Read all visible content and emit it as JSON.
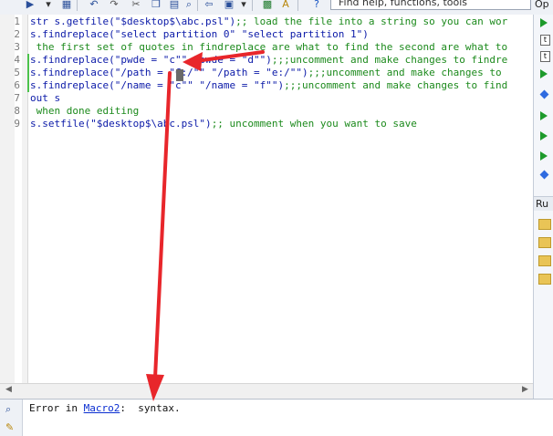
{
  "toolbar": {
    "help_placeholder": "Find help, functions, tools",
    "options_tab": "Op"
  },
  "editor": {
    "lines": [
      {
        "num": "1",
        "code": "str s.getfile(\"$desktop$\\abc.psl\")",
        "comment": ";; load the file into a string so you can wor"
      },
      {
        "num": "2",
        "code": "s.findreplace(\"select partition 0\" \"select partition 1\")",
        "comment": ""
      },
      {
        "num": "3",
        "code": "",
        "comment": " the first set of quotes in findreplace are what to find the second are what to"
      },
      {
        "num": "4",
        "code": "s.findreplace(\"pwde = \"c\"\" \"pwde = \"d\"\")",
        "comment": ";;;uncomment and make changes to findre"
      },
      {
        "num": "5",
        "code": "s.findreplace(\"/path = \"C:/\"\" \"/path = \"e:/\"\")",
        "comment": ";;;uncomment and make changes to"
      },
      {
        "num": "6",
        "code": "s.findreplace(\"/name = \"c\"\" \"/name = \"f\"\")",
        "comment": ";;;uncomment and make changes to find"
      },
      {
        "num": "7",
        "code": "out s",
        "comment": ""
      },
      {
        "num": "8",
        "code": "",
        "comment": " when done editing"
      },
      {
        "num": "9",
        "code": "s.setfile(\"$desktop$\\abc.psl\")",
        "comment": ";; uncomment when you want to save"
      }
    ]
  },
  "output": {
    "prefix": "Error in ",
    "link": "Macro2",
    "suffix": ":  syntax."
  },
  "right_panel": {
    "section_label": "Ru"
  },
  "colors": {
    "code": "#0b1aa8",
    "comment": "#1c8a1c",
    "annotation_arrow": "#e8262b"
  }
}
